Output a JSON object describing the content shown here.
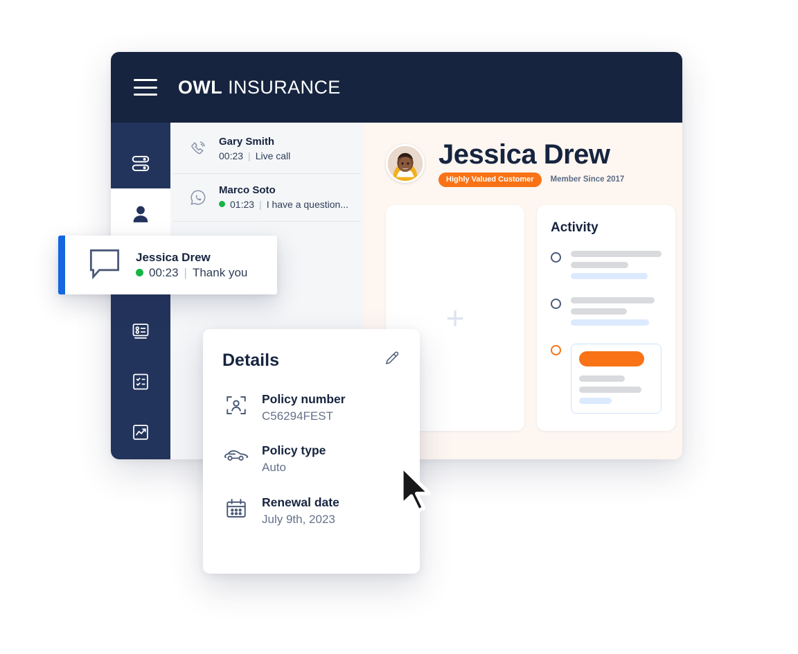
{
  "header": {
    "menu_icon": "hamburger-menu-icon",
    "brand_bold": "OWL",
    "brand_light": "INSURANCE"
  },
  "sidebar": {
    "items": [
      {
        "icon": "toggles-icon",
        "name": "settings-toggles",
        "active": false
      },
      {
        "icon": "person-icon",
        "name": "contacts",
        "active": true
      },
      {
        "icon": "contact-card-icon",
        "name": "directory",
        "active": false
      },
      {
        "icon": "checklist-icon",
        "name": "tasks",
        "active": false
      },
      {
        "icon": "trending-chart-icon",
        "name": "reports",
        "active": false
      }
    ]
  },
  "conversations": [
    {
      "icon": "phone-call-icon",
      "name": "Gary Smith",
      "time": "00:23",
      "separator": "|",
      "preview": "Live call",
      "online": false
    },
    {
      "icon": "whatsapp-icon",
      "name": "Marco Soto",
      "time": "01:23",
      "separator": "|",
      "preview": "I have a question...",
      "online": true
    }
  ],
  "drag_card": {
    "icon": "chat-bubble-icon",
    "name": "Jessica Drew",
    "time": "00:23",
    "separator": "|",
    "preview": "Thank you",
    "accent_color": "#1566e0",
    "online": true
  },
  "profile": {
    "avatar": "customer-avatar-photo",
    "name": "Jessica Drew",
    "badge": "Highly Valued Customer",
    "badge_color": "#f97316",
    "member_since": "Member Since 2017"
  },
  "add_card": {
    "icon": "plus-icon",
    "label": "+"
  },
  "activity": {
    "title": "Activity",
    "items": [
      {
        "state": "default",
        "bars": [
          "wide",
          "medium",
          "blue"
        ]
      },
      {
        "state": "default",
        "bars": [
          "wide",
          "medium",
          "blue"
        ]
      },
      {
        "state": "accent",
        "highlighted": true,
        "bars": [
          "orange",
          "medium",
          "wide",
          "blue-short"
        ]
      }
    ],
    "accent_color": "#f97316"
  },
  "details": {
    "title": "Details",
    "edit_icon": "pencil-edit-icon",
    "rows": [
      {
        "icon": "id-scan-icon",
        "label": "Policy number",
        "value": "C56294FEST"
      },
      {
        "icon": "car-icon",
        "label": "Policy type",
        "value": "Auto"
      },
      {
        "icon": "calendar-icon",
        "label": "Renewal date",
        "value": "July 9th, 2023"
      }
    ]
  },
  "cursor": {
    "icon": "mouse-pointer-cursor"
  }
}
